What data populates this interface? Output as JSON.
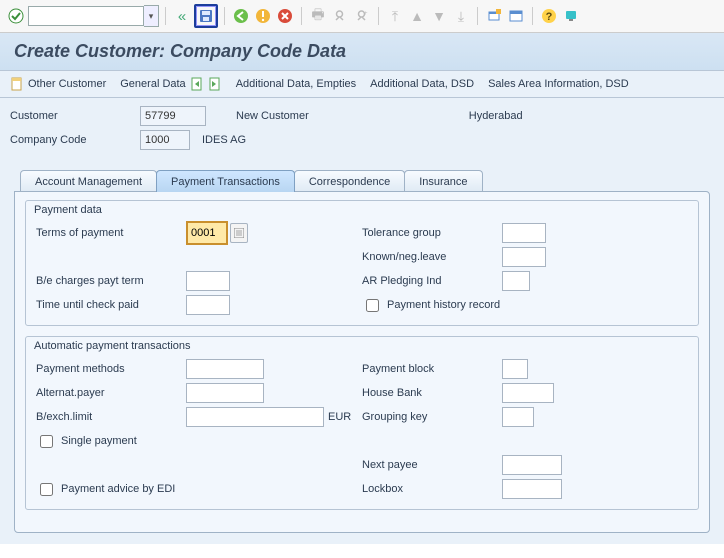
{
  "title": "Create Customer: Company Code Data",
  "toolbar": {
    "command_value": ""
  },
  "apptoolbar": {
    "other_customer": "Other Customer",
    "general_data": "General Data",
    "add_empties": "Additional Data, Empties",
    "add_dsd": "Additional Data, DSD",
    "sales_area_dsd": "Sales Area Information, DSD"
  },
  "header": {
    "customer_lbl": "Customer",
    "customer_val": "57799",
    "customer_desc": "New Customer",
    "city": "Hyderabad",
    "cc_lbl": "Company Code",
    "cc_val": "1000",
    "cc_desc": "IDES AG"
  },
  "tabs": {
    "t1": "Account Management",
    "t2": "Payment Transactions",
    "t3": "Correspondence",
    "t4": "Insurance"
  },
  "group1": {
    "legend": "Payment data",
    "terms_lbl": "Terms of payment",
    "terms_val": "0001",
    "tol_lbl": "Tolerance group",
    "tol_val": "",
    "known_lbl": "Known/neg.leave",
    "known_val": "",
    "be_lbl": "B/e charges payt term",
    "be_val": "",
    "ar_lbl": "AR Pledging Ind",
    "ar_val": "",
    "time_lbl": "Time until check paid",
    "time_val": "",
    "hist_lbl": "Payment history record"
  },
  "group2": {
    "legend": "Automatic payment transactions",
    "pm_lbl": "Payment methods",
    "pm_val": "",
    "pb_lbl": "Payment block",
    "pb_val": "",
    "ap_lbl": "Alternat.payer",
    "ap_val": "",
    "hb_lbl": "House Bank",
    "hb_val": "",
    "bel_lbl": "B/exch.limit",
    "bel_val": "",
    "bel_cur": "EUR",
    "gk_lbl": "Grouping key",
    "gk_val": "",
    "sp_lbl": "Single payment",
    "np_lbl": "Next payee",
    "np_val": "",
    "edi_lbl": "Payment advice by EDI",
    "lb_lbl": "Lockbox",
    "lb_val": ""
  }
}
